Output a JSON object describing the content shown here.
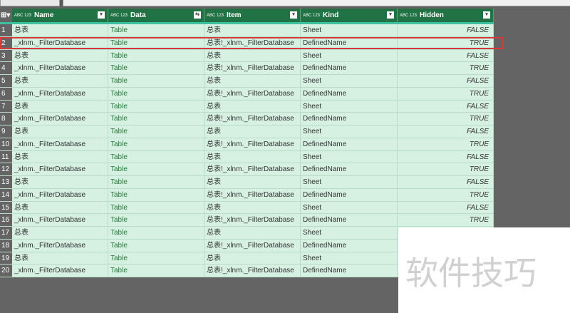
{
  "columns": [
    {
      "label": "Name",
      "type": "ABC 123",
      "control": "▾"
    },
    {
      "label": "Data",
      "type": "ABC 123",
      "control": "⇆"
    },
    {
      "label": "Item",
      "type": "ABC 123",
      "control": "▾"
    },
    {
      "label": "Kind",
      "type": "ABC 123",
      "control": "▾"
    },
    {
      "label": "Hidden",
      "type": "ABC 123",
      "control": "▾"
    }
  ],
  "rows": [
    [
      "1",
      "总表",
      "Table",
      "总表",
      "Sheet",
      "FALSE"
    ],
    [
      "2",
      "_xlnm._FilterDatabase",
      "Table",
      "总表!_xlnm._FilterDatabase",
      "DefinedName",
      "TRUE"
    ],
    [
      "3",
      "总表",
      "Table",
      "总表",
      "Sheet",
      "FALSE"
    ],
    [
      "4",
      "_xlnm._FilterDatabase",
      "Table",
      "总表!_xlnm._FilterDatabase",
      "DefinedName",
      "TRUE"
    ],
    [
      "5",
      "总表",
      "Table",
      "总表",
      "Sheet",
      "FALSE"
    ],
    [
      "6",
      "_xlnm._FilterDatabase",
      "Table",
      "总表!_xlnm._FilterDatabase",
      "DefinedName",
      "TRUE"
    ],
    [
      "7",
      "总表",
      "Table",
      "总表",
      "Sheet",
      "FALSE"
    ],
    [
      "8",
      "_xlnm._FilterDatabase",
      "Table",
      "总表!_xlnm._FilterDatabase",
      "DefinedName",
      "TRUE"
    ],
    [
      "9",
      "总表",
      "Table",
      "总表",
      "Sheet",
      "FALSE"
    ],
    [
      "10",
      "_xlnm._FilterDatabase",
      "Table",
      "总表!_xlnm._FilterDatabase",
      "DefinedName",
      "TRUE"
    ],
    [
      "11",
      "总表",
      "Table",
      "总表",
      "Sheet",
      "FALSE"
    ],
    [
      "12",
      "_xlnm._FilterDatabase",
      "Table",
      "总表!_xlnm._FilterDatabase",
      "DefinedName",
      "TRUE"
    ],
    [
      "13",
      "总表",
      "Table",
      "总表",
      "Sheet",
      "FALSE"
    ],
    [
      "14",
      "_xlnm._FilterDatabase",
      "Table",
      "总表!_xlnm._FilterDatabase",
      "DefinedName",
      "TRUE"
    ],
    [
      "15",
      "总表",
      "Table",
      "总表",
      "Sheet",
      "FALSE"
    ],
    [
      "16",
      "_xlnm._FilterDatabase",
      "Table",
      "总表!_xlnm._FilterDatabase",
      "DefinedName",
      "TRUE"
    ],
    [
      "17",
      "总表",
      "Table",
      "总表",
      "Sheet",
      ""
    ],
    [
      "18",
      "_xlnm._FilterDatabase",
      "Table",
      "总表!_xlnm._FilterDatabase",
      "DefinedName",
      ""
    ],
    [
      "19",
      "总表",
      "Table",
      "总表",
      "Sheet",
      ""
    ],
    [
      "20",
      "_xlnm._FilterDatabase",
      "Table",
      "总表!_xlnm._FilterDatabase",
      "DefinedName",
      ""
    ]
  ],
  "watermark": "软件技巧"
}
